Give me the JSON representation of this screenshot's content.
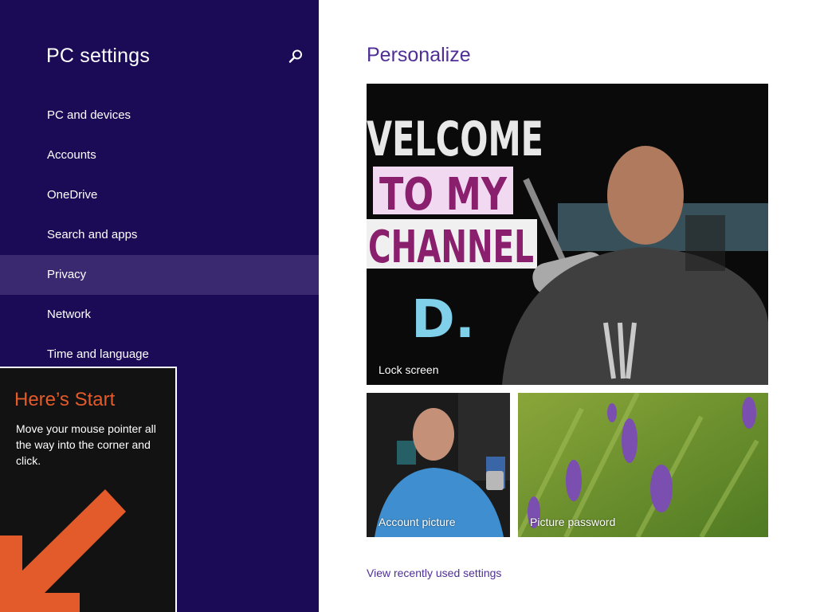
{
  "nav": {
    "title": "PC settings",
    "search_icon": "search-icon",
    "items": [
      {
        "label": "PC and devices",
        "selected": false
      },
      {
        "label": "Accounts",
        "selected": false
      },
      {
        "label": "OneDrive",
        "selected": false
      },
      {
        "label": "Search and apps",
        "selected": false
      },
      {
        "label": "Privacy",
        "selected": true
      },
      {
        "label": "Network",
        "selected": false
      },
      {
        "label": "Time and language",
        "selected": false
      }
    ]
  },
  "tip": {
    "title": "Here’s Start",
    "body": "Move your mouse pointer all the way into the corner and click.",
    "arrow_icon": "arrow-down-left-icon",
    "accent": "#e35a2b"
  },
  "main": {
    "title": "Personalize",
    "tiles": {
      "lock_screen": {
        "label": "Lock screen",
        "image_text": [
          "VELCOME",
          "TO MY",
          "CHANNEL",
          "D."
        ]
      },
      "account_picture": {
        "label": "Account picture"
      },
      "picture_password": {
        "label": "Picture password"
      }
    },
    "recent_link": "View recently used settings"
  },
  "colors": {
    "nav_bg": "#1b0a55",
    "nav_selected": "#3a2870",
    "accent_text": "#4f2f96"
  }
}
